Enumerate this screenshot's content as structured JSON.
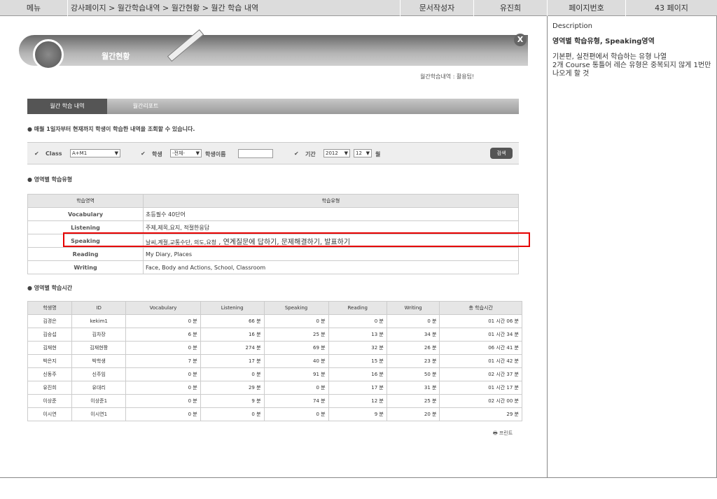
{
  "topbar": {
    "menu": "메뉴",
    "breadcrumb": "강사페이지 > 월간학습내역 > 월간현황 > 월간 학습 내역",
    "author_label": "문서작성자",
    "author": "유진희",
    "page_no_label": "페이지번호",
    "page_no": "43 페이지"
  },
  "banner": {
    "title": "월간현황",
    "close": "X",
    "subnav": "월간학습내역 : 활용팁!"
  },
  "tabs": [
    {
      "label": "월간 학습 내역"
    },
    {
      "label": "월간리포트"
    }
  ],
  "note": "● 매월 1일자부터 현재까지 학생이 학습한 내역을 조회할 수 있습니다.",
  "filters": {
    "class_label": "Class",
    "class_value": "A+M1",
    "student_label": "학생",
    "student_value": "-전체-",
    "name_label": "학생이름",
    "period_label": "기간",
    "year": "2012",
    "month": "12",
    "month_unit": "월",
    "search": "검색"
  },
  "section1": {
    "title": "● 영역별 학습유형",
    "headers": [
      "학습영역",
      "학습유형"
    ],
    "rows": [
      {
        "area": "Vocabulary",
        "type": "초등필수 40단어",
        "extra": ""
      },
      {
        "area": "Listening",
        "type": "주제,제목,요지, 적절한응답",
        "extra": ""
      },
      {
        "area": "Speaking",
        "type": "날씨,계절,교통수단, 의도,요청",
        "extra": " , 연계질문에 답하기, 문제해결하기, 발표하기"
      },
      {
        "area": "Reading",
        "type": "My Diary, Places",
        "extra": ""
      },
      {
        "area": "Writing",
        "type": "Face, Body and Actions, School, Classroom",
        "extra": ""
      }
    ]
  },
  "section2": {
    "title": "● 영역별 학습시간",
    "headers": [
      "학생명",
      "ID",
      "Vocabulary",
      "Listening",
      "Speaking",
      "Reading",
      "Writing",
      "총 학습시간"
    ],
    "rows": [
      [
        "김경은",
        "kekim1",
        "0 분",
        "66 분",
        "0 분",
        "0 분",
        "0 분",
        "01 시간  06 분"
      ],
      [
        "김승섭",
        "김차장",
        "6 분",
        "16 분",
        "25 분",
        "13 분",
        "34 분",
        "01 시간  34 분"
      ],
      [
        "김재현",
        "김재현짱",
        "0 분",
        "274 분",
        "69 분",
        "32 분",
        "26 분",
        "06 시간  41 분"
      ],
      [
        "박은지",
        "박학생",
        "7 분",
        "17 분",
        "40 분",
        "15 분",
        "23 분",
        "01 시간  42 분"
      ],
      [
        "신동주",
        "신주임",
        "0 분",
        "0 분",
        "91 분",
        "16 분",
        "50 분",
        "02 시간  37 분"
      ],
      [
        "유진희",
        "유대리",
        "0 분",
        "29 분",
        "0 분",
        "17 분",
        "31 분",
        "01 시간  17 분"
      ],
      [
        "이상준",
        "이상준1",
        "0 분",
        "9 분",
        "74 분",
        "12 분",
        "25 분",
        "02 시간  00 분"
      ],
      [
        "이시연",
        "이시연1",
        "0 분",
        "0 분",
        "0 분",
        "9 분",
        "20 분",
        "29 분"
      ]
    ]
  },
  "print": "프린트",
  "description": {
    "title": "Description",
    "head": "영역별 학습유형, Speaking영역",
    "body1": "기본편, 실전편에서 학습하는 유형 나열",
    "body2": "2개 Course 통틀어  레슨 유형은 중복되지 않게 1번만 나오게 할 것"
  }
}
